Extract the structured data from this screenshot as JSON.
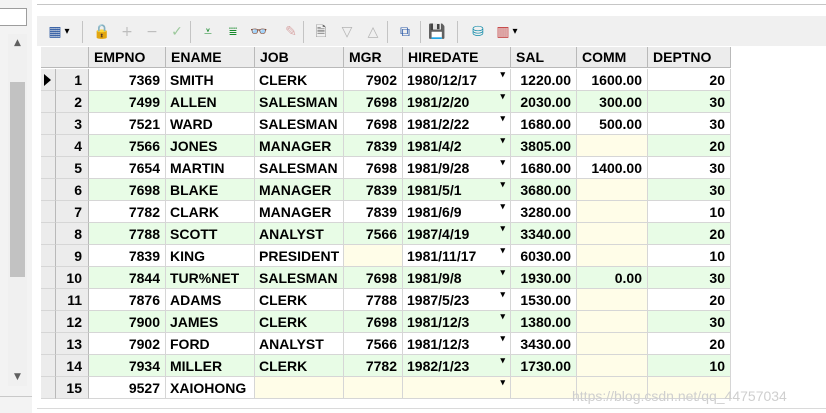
{
  "columns": [
    "EMPNO",
    "ENAME",
    "JOB",
    "MGR",
    "HIREDATE",
    "SAL",
    "COMM",
    "DEPTNO"
  ],
  "rows": [
    {
      "n": "1",
      "EMPNO": "7369",
      "ENAME": "SMITH",
      "JOB": "CLERK",
      "MGR": "7902",
      "HIREDATE": "1980/12/17",
      "SAL": "1220.00",
      "COMM": "1600.00",
      "DEPTNO": "20"
    },
    {
      "n": "2",
      "EMPNO": "7499",
      "ENAME": "ALLEN",
      "JOB": "SALESMAN",
      "MGR": "7698",
      "HIREDATE": "1981/2/20",
      "SAL": "2030.00",
      "COMM": "300.00",
      "DEPTNO": "30"
    },
    {
      "n": "3",
      "EMPNO": "7521",
      "ENAME": "WARD",
      "JOB": "SALESMAN",
      "MGR": "7698",
      "HIREDATE": "1981/2/22",
      "SAL": "1680.00",
      "COMM": "500.00",
      "DEPTNO": "30"
    },
    {
      "n": "4",
      "EMPNO": "7566",
      "ENAME": "JONES",
      "JOB": "MANAGER",
      "MGR": "7839",
      "HIREDATE": "1981/4/2",
      "SAL": "3805.00",
      "COMM": "",
      "DEPTNO": "20"
    },
    {
      "n": "5",
      "EMPNO": "7654",
      "ENAME": "MARTIN",
      "JOB": "SALESMAN",
      "MGR": "7698",
      "HIREDATE": "1981/9/28",
      "SAL": "1680.00",
      "COMM": "1400.00",
      "DEPTNO": "30"
    },
    {
      "n": "6",
      "EMPNO": "7698",
      "ENAME": "BLAKE",
      "JOB": "MANAGER",
      "MGR": "7839",
      "HIREDATE": "1981/5/1",
      "SAL": "3680.00",
      "COMM": "",
      "DEPTNO": "30"
    },
    {
      "n": "7",
      "EMPNO": "7782",
      "ENAME": "CLARK",
      "JOB": "MANAGER",
      "MGR": "7839",
      "HIREDATE": "1981/6/9",
      "SAL": "3280.00",
      "COMM": "",
      "DEPTNO": "10"
    },
    {
      "n": "8",
      "EMPNO": "7788",
      "ENAME": "SCOTT",
      "JOB": "ANALYST",
      "MGR": "7566",
      "HIREDATE": "1987/4/19",
      "SAL": "3340.00",
      "COMM": "",
      "DEPTNO": "20"
    },
    {
      "n": "9",
      "EMPNO": "7839",
      "ENAME": "KING",
      "JOB": "PRESIDENT",
      "MGR": "",
      "HIREDATE": "1981/11/17",
      "SAL": "6030.00",
      "COMM": "",
      "DEPTNO": "10"
    },
    {
      "n": "10",
      "EMPNO": "7844",
      "ENAME": "TUR%NET",
      "JOB": "SALESMAN",
      "MGR": "7698",
      "HIREDATE": "1981/9/8",
      "SAL": "1930.00",
      "COMM": "0.00",
      "DEPTNO": "30"
    },
    {
      "n": "11",
      "EMPNO": "7876",
      "ENAME": "ADAMS",
      "JOB": "CLERK",
      "MGR": "7788",
      "HIREDATE": "1987/5/23",
      "SAL": "1530.00",
      "COMM": "",
      "DEPTNO": "20"
    },
    {
      "n": "12",
      "EMPNO": "7900",
      "ENAME": "JAMES",
      "JOB": "CLERK",
      "MGR": "7698",
      "HIREDATE": "1981/12/3",
      "SAL": "1380.00",
      "COMM": "",
      "DEPTNO": "30"
    },
    {
      "n": "13",
      "EMPNO": "7902",
      "ENAME": "FORD",
      "JOB": "ANALYST",
      "MGR": "7566",
      "HIREDATE": "1981/12/3",
      "SAL": "3430.00",
      "COMM": "",
      "DEPTNO": "20"
    },
    {
      "n": "14",
      "EMPNO": "7934",
      "ENAME": "MILLER",
      "JOB": "CLERK",
      "MGR": "7782",
      "HIREDATE": "1982/1/23",
      "SAL": "1730.00",
      "COMM": "",
      "DEPTNO": "10"
    },
    {
      "n": "15",
      "EMPNO": "9527",
      "ENAME": "XAIOHONG",
      "JOB": "",
      "MGR": "",
      "HIREDATE": "",
      "SAL": "",
      "COMM": "",
      "DEPTNO": ""
    }
  ],
  "toolbar": [
    {
      "name": "grid-layout-icon",
      "glyph": "▦",
      "color": "#1f4e9c",
      "label": "▾"
    },
    {
      "name": "lock-icon",
      "glyph": "🔒",
      "color": "#7a7a7a"
    },
    {
      "name": "add-record-icon",
      "glyph": "+",
      "color": "#bdbdbd"
    },
    {
      "name": "delete-record-icon",
      "glyph": "−",
      "color": "#bdbdbd"
    },
    {
      "name": "post-check-icon",
      "glyph": "✓",
      "color": "#9bc89b"
    },
    {
      "name": "next-record-icon",
      "glyph": "⩡",
      "color": "#178a2c"
    },
    {
      "name": "last-record-icon",
      "glyph": "⩸",
      "color": "#178a2c"
    },
    {
      "name": "find-binoculars-icon",
      "glyph": "👓",
      "color": "#222222"
    },
    {
      "name": "clear-eraser-icon",
      "glyph": "✎",
      "color": "#d9a8a8"
    },
    {
      "name": "query-icon",
      "glyph": "🗎",
      "color": "#6a6a6a"
    },
    {
      "name": "sort-down-icon",
      "glyph": "▽",
      "color": "#b5b5b5"
    },
    {
      "name": "sort-up-icon",
      "glyph": "△",
      "color": "#b5b5b5"
    },
    {
      "name": "tree-view-icon",
      "glyph": "⧉",
      "color": "#2b5aa8"
    },
    {
      "name": "save-disk-icon",
      "glyph": "💾",
      "color": "#222222"
    },
    {
      "name": "database-icon",
      "glyph": "⛁",
      "color": "#0f8aa8"
    },
    {
      "name": "chart-icon",
      "glyph": "▥",
      "color": "#c03030",
      "label": "▾"
    }
  ],
  "watermark": "https://blog.csdn.net/qq_44757034",
  "colors": {
    "row_alt": "#e8fce6",
    "row": "#ffffff",
    "null_cell": "#fffde8",
    "header": "#ececec"
  }
}
